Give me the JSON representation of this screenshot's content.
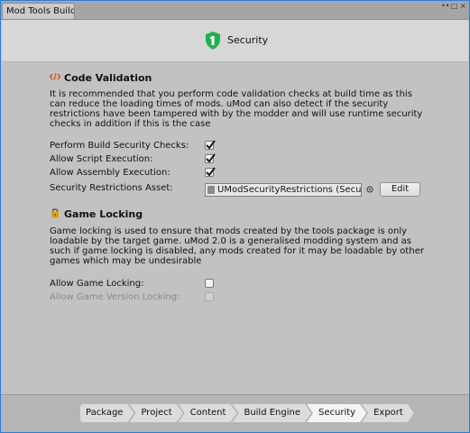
{
  "window": {
    "tab_title": "Mod Tools Build",
    "controls": [
      "••",
      "□",
      "×"
    ]
  },
  "header": {
    "title": "Security"
  },
  "code_validation": {
    "title": "Code Validation",
    "description": "It is recommended that you perform code validation checks at build time as this can reduce the loading times of mods. uMod can also detect if the security restrictions have been tampered with by the modder and will use runtime security checks in addition if this is the case",
    "options": [
      {
        "label": "Perform Build Security Checks:",
        "checked": true
      },
      {
        "label": "Allow Script Execution:",
        "checked": true
      },
      {
        "label": "Allow Assembly Execution:",
        "checked": true
      }
    ],
    "asset_label": "Security Restrictions Asset:",
    "asset_value": "UModSecurityRestrictions (Securi",
    "edit_label": "Edit"
  },
  "game_locking": {
    "title": "Game Locking",
    "description": "Game locking is used to ensure that mods created by the tools package is only loadable by the target game. uMod 2.0 is a generalised modding system and as such if game locking is disabled, any mods created for it may be loadable by other games which may be undesirable",
    "options": [
      {
        "label": "Allow Game Locking:",
        "checked": false,
        "enabled": true
      },
      {
        "label": "Allow Game Version Locking:",
        "checked": false,
        "enabled": false
      }
    ]
  },
  "footer": {
    "steps": [
      "Package",
      "Project",
      "Content",
      "Build Engine",
      "Security",
      "Export"
    ],
    "active_step": "Security"
  },
  "colors": {
    "shield": "#21b04b",
    "code_icon": "#d9512c",
    "lock": "#d9a21c",
    "window_border": "#2a7fd4"
  }
}
